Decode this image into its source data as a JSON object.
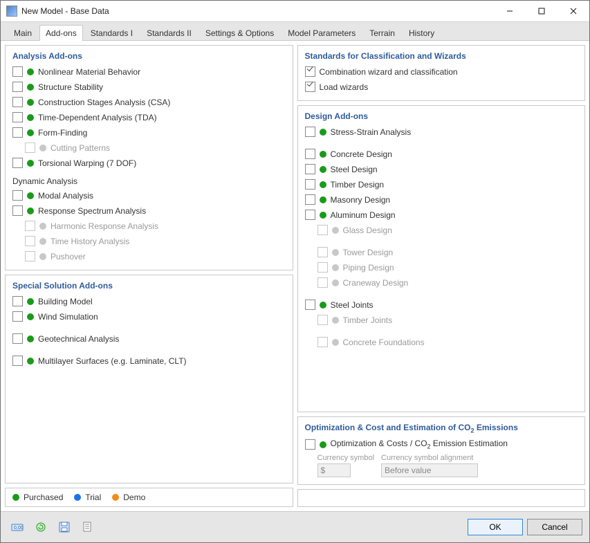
{
  "window": {
    "title": "New Model - Base Data"
  },
  "tabs": [
    {
      "label": "Main",
      "active": false
    },
    {
      "label": "Add-ons",
      "active": true
    },
    {
      "label": "Standards I",
      "active": false
    },
    {
      "label": "Standards II",
      "active": false
    },
    {
      "label": "Settings & Options",
      "active": false
    },
    {
      "label": "Model Parameters",
      "active": false
    },
    {
      "label": "Terrain",
      "active": false
    },
    {
      "label": "History",
      "active": false
    }
  ],
  "panels": {
    "analysis": {
      "title": "Analysis Add-ons",
      "items": [
        {
          "label": "Nonlinear Material Behavior",
          "status": "purchased",
          "checked": false,
          "enabled": true
        },
        {
          "label": "Structure Stability",
          "status": "purchased",
          "checked": false,
          "enabled": true
        },
        {
          "label": "Construction Stages Analysis (CSA)",
          "status": "purchased",
          "checked": false,
          "enabled": true
        },
        {
          "label": "Time-Dependent Analysis (TDA)",
          "status": "purchased",
          "checked": false,
          "enabled": true
        },
        {
          "label": "Form-Finding",
          "status": "purchased",
          "checked": false,
          "enabled": true
        },
        {
          "label": "Cutting Patterns",
          "status": "disabled",
          "checked": false,
          "enabled": false,
          "indent": true
        },
        {
          "label": "Torsional Warping (7 DOF)",
          "status": "purchased",
          "checked": false,
          "enabled": true
        }
      ],
      "dynamic_header": "Dynamic Analysis",
      "dynamic": [
        {
          "label": "Modal Analysis",
          "status": "purchased",
          "checked": false,
          "enabled": true
        },
        {
          "label": "Response Spectrum Analysis",
          "status": "purchased",
          "checked": false,
          "enabled": true
        },
        {
          "label": "Harmonic Response Analysis",
          "status": "disabled",
          "checked": false,
          "enabled": false,
          "indent": true
        },
        {
          "label": "Time History Analysis",
          "status": "disabled",
          "checked": false,
          "enabled": false,
          "indent": true
        },
        {
          "label": "Pushover",
          "status": "disabled",
          "checked": false,
          "enabled": false,
          "indent": true
        }
      ]
    },
    "special": {
      "title": "Special Solution Add-ons",
      "items": [
        {
          "label": "Building Model",
          "status": "purchased",
          "checked": false,
          "enabled": true
        },
        {
          "label": "Wind Simulation",
          "status": "purchased",
          "checked": false,
          "enabled": true
        },
        {
          "label": "Geotechnical Analysis",
          "status": "purchased",
          "checked": false,
          "enabled": true,
          "gap_before": true
        },
        {
          "label": "Multilayer Surfaces (e.g. Laminate, CLT)",
          "status": "purchased",
          "checked": false,
          "enabled": true,
          "gap_before": true
        }
      ]
    },
    "standards_wiz": {
      "title": "Standards for Classification and Wizards",
      "items": [
        {
          "label": "Combination wizard and classification",
          "checked": true
        },
        {
          "label": "Load wizards",
          "checked": true
        }
      ]
    },
    "design": {
      "title": "Design Add-ons",
      "items": [
        {
          "label": "Stress-Strain Analysis",
          "status": "purchased",
          "checked": false,
          "enabled": true
        },
        {
          "label": "Concrete Design",
          "status": "purchased",
          "checked": false,
          "enabled": true,
          "gap_before": true
        },
        {
          "label": "Steel Design",
          "status": "purchased",
          "checked": false,
          "enabled": true
        },
        {
          "label": "Timber Design",
          "status": "purchased",
          "checked": false,
          "enabled": true
        },
        {
          "label": "Masonry Design",
          "status": "purchased",
          "checked": false,
          "enabled": true
        },
        {
          "label": "Aluminum Design",
          "status": "purchased",
          "checked": false,
          "enabled": true
        },
        {
          "label": "Glass Design",
          "status": "disabled",
          "checked": false,
          "enabled": false,
          "indent": true
        },
        {
          "label": "Tower Design",
          "status": "disabled",
          "checked": false,
          "enabled": false,
          "indent": true,
          "gap_before": true
        },
        {
          "label": "Piping Design",
          "status": "disabled",
          "checked": false,
          "enabled": false,
          "indent": true
        },
        {
          "label": "Craneway Design",
          "status": "disabled",
          "checked": false,
          "enabled": false,
          "indent": true
        },
        {
          "label": "Steel Joints",
          "status": "purchased",
          "checked": false,
          "enabled": true,
          "gap_before": true
        },
        {
          "label": "Timber Joints",
          "status": "disabled",
          "checked": false,
          "enabled": false,
          "indent": true
        },
        {
          "label": "Concrete Foundations",
          "status": "disabled",
          "checked": false,
          "enabled": false,
          "indent": true,
          "gap_before": true
        }
      ]
    },
    "optimization": {
      "title": "Optimization & Cost and Estimation of CO₂ Emissions",
      "item": {
        "label": "Optimization & Costs / CO₂ Emission Estimation",
        "status": "purchased",
        "checked": false,
        "enabled": true
      },
      "currency_label": "Currency symbol",
      "currency_value": "$",
      "alignment_label": "Currency symbol alignment",
      "alignment_value": "Before value"
    }
  },
  "legend": {
    "purchased": "Purchased",
    "trial": "Trial",
    "demo": "Demo"
  },
  "toolbar": {
    "icons": [
      "units-icon",
      "convert-icon",
      "save-template-icon",
      "load-template-icon"
    ]
  },
  "buttons": {
    "ok": "OK",
    "cancel": "Cancel"
  }
}
